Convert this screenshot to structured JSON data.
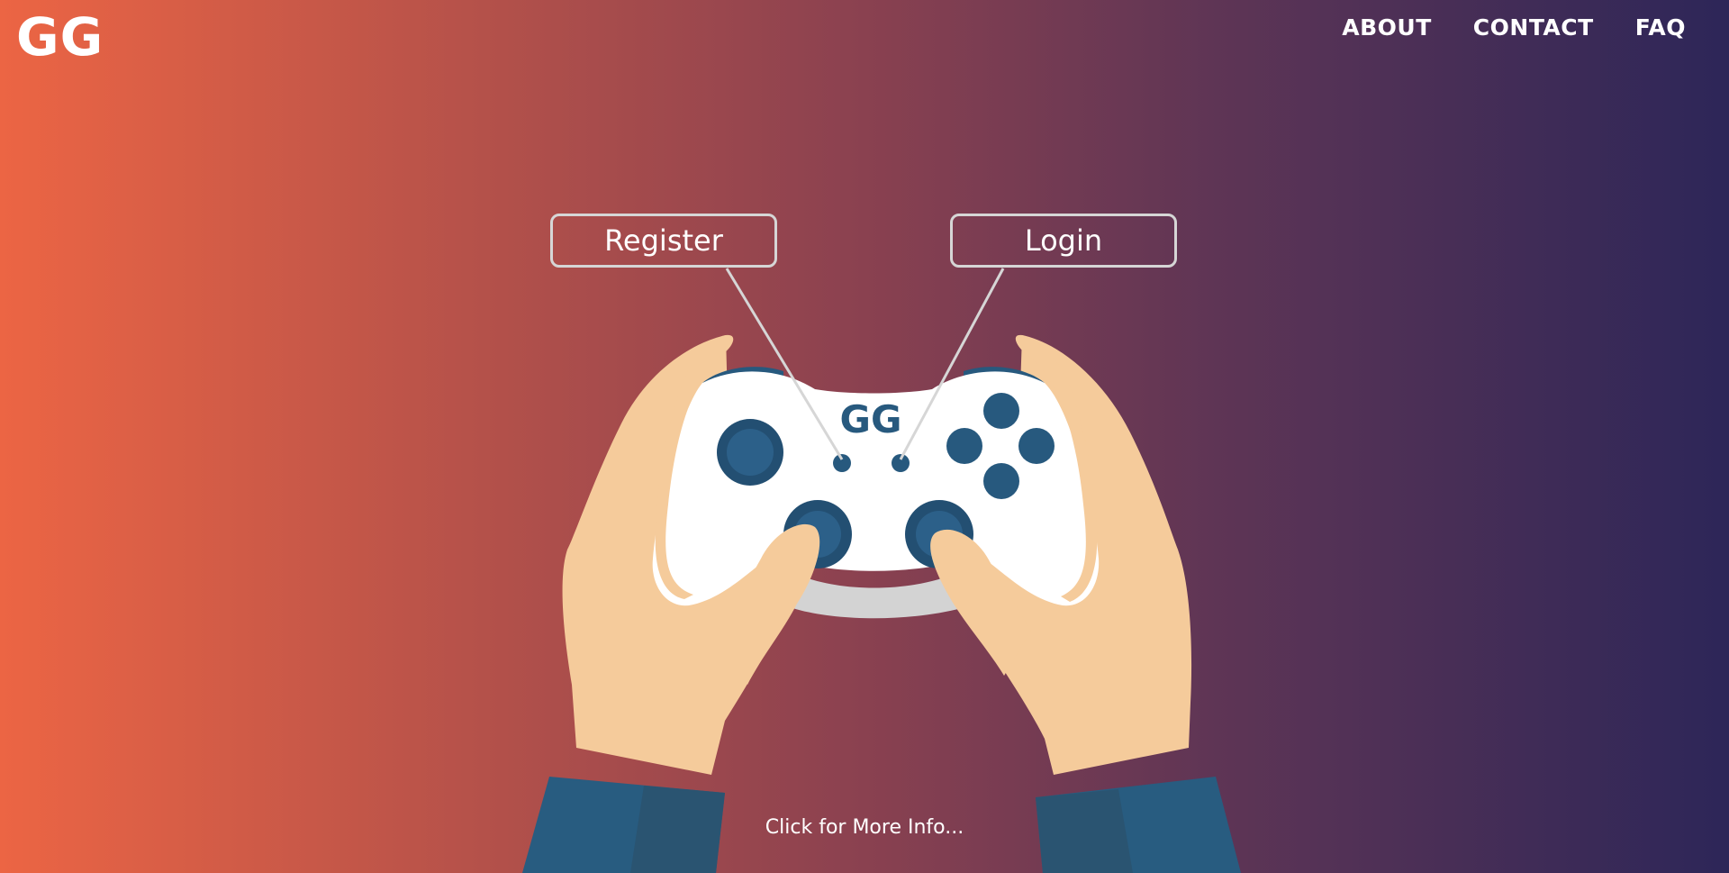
{
  "header": {
    "logo": "GG",
    "nav": [
      {
        "label": "ABOUT"
      },
      {
        "label": "CONTACT"
      },
      {
        "label": "FAQ"
      }
    ]
  },
  "hero": {
    "register_label": "Register",
    "login_label": "Login",
    "controller_logo": "GG",
    "more_info_label": "Click for More Info..."
  },
  "colors": {
    "gradient_left": "#ec6544",
    "gradient_right": "#2d2658",
    "skin": "#f5cb9b",
    "sleeve": "#285c80",
    "controller_body": "#ffffff",
    "controller_buttons": "#27597e"
  }
}
